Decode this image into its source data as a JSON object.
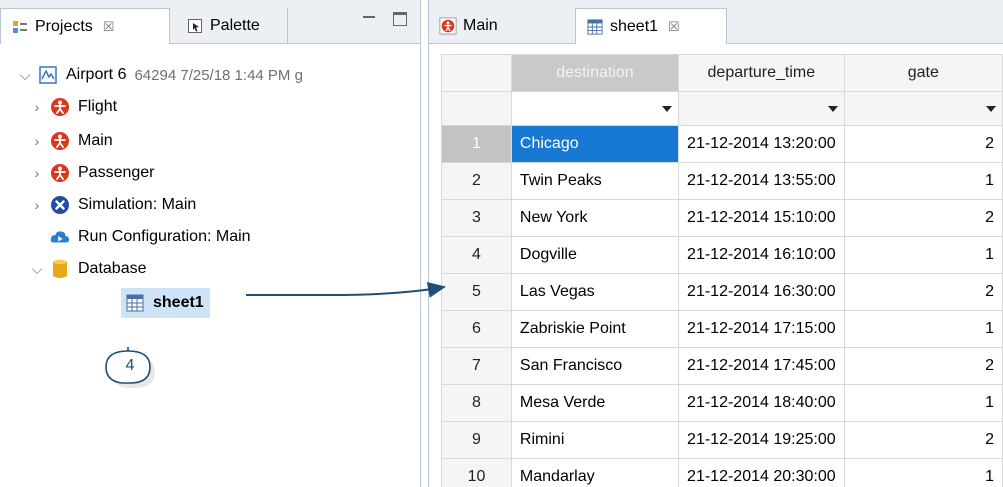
{
  "projects_panel": {
    "tabs": [
      {
        "label": "Projects",
        "close": "☒"
      },
      {
        "label": "Palette"
      }
    ],
    "tree": {
      "root": {
        "label": "Airport 6",
        "meta": "64294 7/25/18 1:44 PM g"
      },
      "items": [
        {
          "label": "Flight",
          "icon": "agent-icon"
        },
        {
          "label": "Main",
          "icon": "agent-icon"
        },
        {
          "label": "Passenger",
          "icon": "agent-icon"
        },
        {
          "label": "Simulation: Main",
          "icon": "simulation-icon"
        },
        {
          "label": "Run Configuration: Main",
          "icon": "run-configuration-icon"
        },
        {
          "label": "Database",
          "icon": "database-icon"
        },
        {
          "label": "sheet1",
          "icon": "table-icon"
        }
      ]
    },
    "callout": "4"
  },
  "editor": {
    "tabs": [
      {
        "label": "Main"
      },
      {
        "label": "sheet1",
        "close": "☒"
      }
    ],
    "table": {
      "columns": [
        "destination",
        "departure_time",
        "gate"
      ],
      "rows": [
        {
          "n": "1",
          "destination": "Chicago",
          "departure_time": "21-12-2014 13:20:00",
          "gate": "2"
        },
        {
          "n": "2",
          "destination": "Twin Peaks",
          "departure_time": "21-12-2014 13:55:00",
          "gate": "1"
        },
        {
          "n": "3",
          "destination": "New York",
          "departure_time": "21-12-2014 15:10:00",
          "gate": "2"
        },
        {
          "n": "4",
          "destination": "Dogville",
          "departure_time": "21-12-2014 16:10:00",
          "gate": "1"
        },
        {
          "n": "5",
          "destination": "Las Vegas",
          "departure_time": "21-12-2014 16:30:00",
          "gate": "2"
        },
        {
          "n": "6",
          "destination": "Zabriskie Point",
          "departure_time": "21-12-2014 17:15:00",
          "gate": "1"
        },
        {
          "n": "7",
          "destination": "San Francisco",
          "departure_time": "21-12-2014 17:45:00",
          "gate": "2"
        },
        {
          "n": "8",
          "destination": "Mesa Verde",
          "departure_time": "21-12-2014 18:40:00",
          "gate": "1"
        },
        {
          "n": "9",
          "destination": "Rimini",
          "departure_time": "21-12-2014 19:25:00",
          "gate": "2"
        },
        {
          "n": "10",
          "destination": "Mandarlay",
          "departure_time": "21-12-2014 20:30:00",
          "gate": "1"
        }
      ]
    }
  },
  "colors": {
    "selection": "#1779d4",
    "agent_icon": "#d9381e",
    "simulation_icon": "#1f4ea8",
    "run_config_icon": "#2a7fd0",
    "database_icon": "#e5a817",
    "arrow": "#1f4e79"
  }
}
